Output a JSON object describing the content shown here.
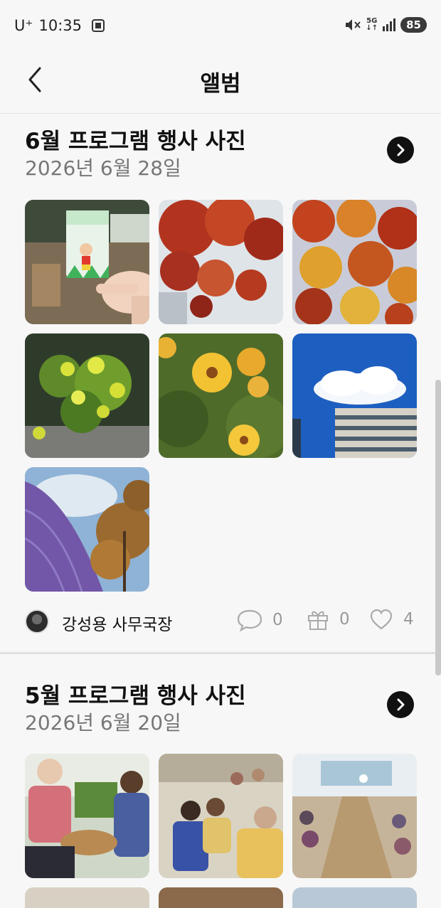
{
  "status_bar": {
    "carrier": "U⁺",
    "time": "10:35",
    "network": "5G",
    "battery": "85"
  },
  "header": {
    "title": "앨범"
  },
  "albums": [
    {
      "title": "6월 프로그램 행사 사진",
      "date": "2026년 6월 28일",
      "photos": [
        "keychain-card",
        "red-maple-leaves",
        "autumn-maple-leaves",
        "yellow-sedum-flowers",
        "yellow-coreopsis-flowers",
        "cloud-building-sky",
        "autumn-tree-purple-building"
      ],
      "author": "강성용 사무국장",
      "comments": "0",
      "gifts": "0",
      "likes": "4"
    },
    {
      "title": "5월 프로그램 행사 사진",
      "date": "2026년 6월 20일",
      "photos": [
        "seniors-basket-activity",
        "seniors-wheelchair-exercise",
        "hall-group-exercise"
      ]
    }
  ],
  "icons": {
    "back": "chevron-left-icon",
    "go": "chevron-right-circle-icon",
    "comment": "comment-icon",
    "gift": "gift-icon",
    "like": "heart-icon"
  }
}
